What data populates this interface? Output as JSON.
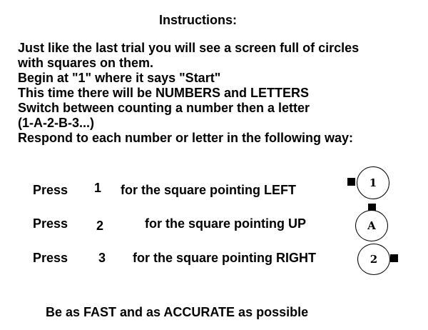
{
  "title": "Instructions:",
  "lines": [
    "Just like the last trial you will see a screen full of circles",
    "with squares on them.",
    "Begin at \"1\" where it says \"Start\"",
    "This time there will be NUMBERS and LETTERS",
    "Switch between counting a number then a letter",
    "(1-A-2-B-3...)",
    "Respond to each number or letter in the following way:"
  ],
  "mappings": [
    {
      "press": "Press",
      "key": "1",
      "text": "for the square pointing LEFT",
      "circle": "1",
      "direction": "left"
    },
    {
      "press": "Press",
      "key": "2",
      "text": "for the square pointing UP",
      "circle": "A",
      "direction": "up"
    },
    {
      "press": "Press",
      "key": "3",
      "text": "for the square pointing RIGHT",
      "circle": "2",
      "direction": "right"
    }
  ],
  "footer": "Be as FAST and as ACCURATE as possible"
}
